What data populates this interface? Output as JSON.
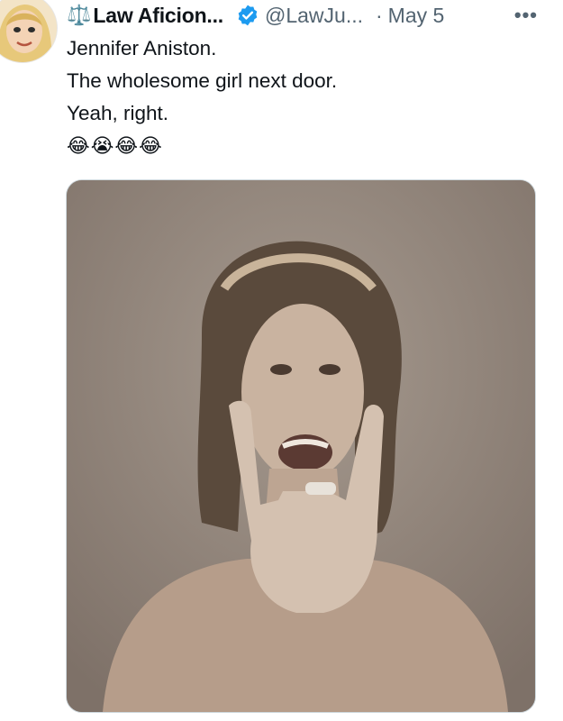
{
  "tweet": {
    "author": {
      "name": "Law Aficion...",
      "name_prefix_emoji": "⚖️",
      "handle": "@LawJu...",
      "verified": true,
      "avatar_icon": "cartoon-woman-avatar"
    },
    "separator": "·",
    "date": "May 5",
    "more_label": "•••",
    "text_lines": [
      "Jennifer Aniston.",
      "The wholesome girl next door.",
      "Yeah, right."
    ],
    "emoji_line": "😂😭😂😂",
    "media": {
      "type": "photo",
      "description_icon": "sepia-portrait-photo"
    }
  },
  "colors": {
    "text_primary": "#0f1419",
    "text_secondary": "#536471",
    "verified_blue": "#1d9bf0",
    "photo_background": "#8c7f76"
  }
}
